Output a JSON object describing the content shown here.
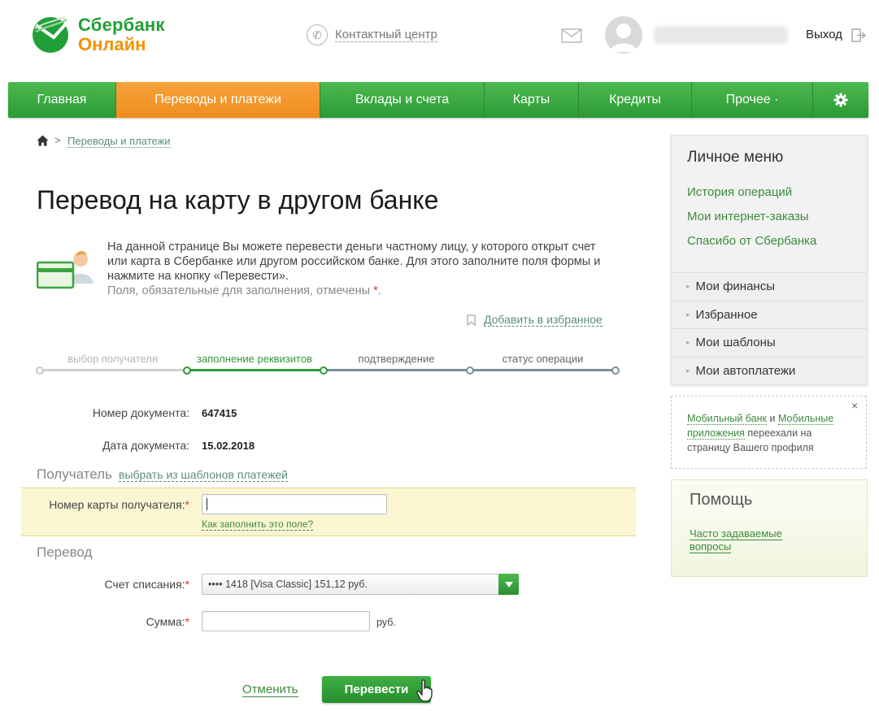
{
  "header": {
    "logo_line1": "Сбербанк",
    "logo_line2": "Онлайн",
    "contact_center": "Контактный центр",
    "logout": "Выход"
  },
  "nav": {
    "items": [
      {
        "label": "Главная",
        "active": false
      },
      {
        "label": "Переводы и платежи",
        "active": true
      },
      {
        "label": "Вклады и счета",
        "active": false
      },
      {
        "label": "Карты",
        "active": false
      },
      {
        "label": "Кредиты",
        "active": false
      },
      {
        "label": "Прочее ·",
        "active": false
      }
    ],
    "settings_icon": "gear-icon"
  },
  "breadcrumb": {
    "separator": ">",
    "link": "Переводы и платежи"
  },
  "page": {
    "title": "Перевод на карту в другом банке",
    "info_text": "На данной странице Вы можете перевести деньги частному лицу, у которого открыт счет или карта в Сбербанке или другом российском банке. Для этого заполните поля формы и нажмите на кнопку «Перевести».",
    "required_hint": "Поля, обязательные для заполнения, отмечены",
    "required_mark": "*",
    "required_dot": ".",
    "add_favorite": "Добавить в избранное"
  },
  "steps": [
    {
      "label": "выбор получателя",
      "state": "done"
    },
    {
      "label": "заполнение реквизитов",
      "state": "current"
    },
    {
      "label": "подтверждение",
      "state": "pending"
    },
    {
      "label": "статус операции",
      "state": "pending"
    }
  ],
  "document": {
    "number_label": "Номер документа:",
    "number_value": "647415",
    "date_label": "Дата документа:",
    "date_value": "15.02.2018"
  },
  "recipient": {
    "section_title": "Получатель",
    "templates_link": "выбрать из шаблонов платежей",
    "card_label": "Номер карты получателя:",
    "card_value": "",
    "help_link": "Как заполнить это поле?"
  },
  "transfer": {
    "section_title": "Перевод",
    "account_label": "Счет списания:",
    "account_value": "•••• 1418  [Visa Classic] 151,12  руб.",
    "amount_label": "Сумма:",
    "amount_value": "",
    "currency": "руб."
  },
  "actions": {
    "cancel": "Отменить",
    "submit": "Перевести"
  },
  "sidebar": {
    "title": "Личное меню",
    "links": [
      "История операций",
      "Мои интернет-заказы",
      "Спасибо от Сбербанка"
    ],
    "sections": [
      "Мои финансы",
      "Избранное",
      "Мои шаблоны",
      "Мои автоплатежи"
    ]
  },
  "notice": {
    "link1": "Мобильный банк",
    "and": "и",
    "link2": "Мобильные приложения",
    "text": "переехали на страницу Вашего профиля",
    "close": "×"
  },
  "help": {
    "title": "Помощь",
    "link": "Часто задаваемые вопросы"
  },
  "colors": {
    "brand_green": "#21a038",
    "brand_orange": "#f39200",
    "link_green": "#3d8a3d"
  }
}
